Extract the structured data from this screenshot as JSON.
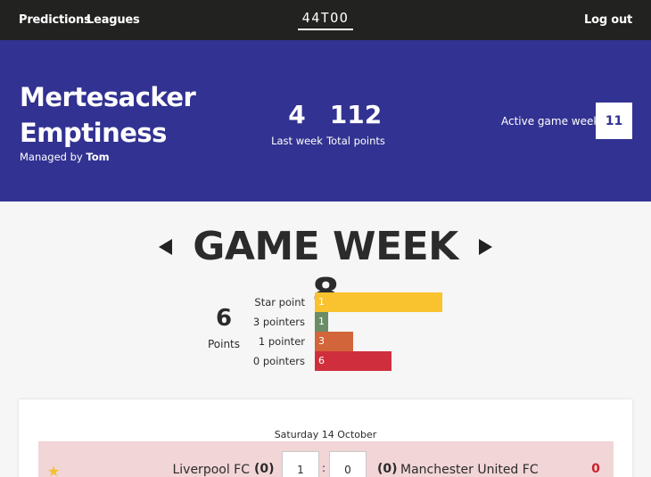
{
  "nav": {
    "predictions": "Predictions",
    "leagues": "Leagues",
    "logo": "44TOO",
    "logout": "Log out"
  },
  "hero": {
    "team_name": "Mertesacker Emptiness",
    "managed_by_prefix": "Managed by",
    "manager": "Tom",
    "last_week_value": "4",
    "last_week_label": "Last week",
    "total_points_value": "112",
    "total_points_label": "Total points",
    "active_game_week_label": "Active game week",
    "active_game_week_value": "11"
  },
  "game_week": {
    "title": "GAME WEEK 8",
    "points_value": "6",
    "points_label": "Points",
    "breakdown": [
      {
        "label": "Star point",
        "count": 1,
        "color": "#f9c22f"
      },
      {
        "label": "3 pointers",
        "count": 1,
        "color": "#6a8c67"
      },
      {
        "label": "1 pointer",
        "count": 3,
        "color": "#d2653a"
      },
      {
        "label": "0 pointers",
        "count": 6,
        "color": "#cf2f3c"
      }
    ]
  },
  "fixtures": {
    "date": "Saturday 14 October",
    "matches": [
      {
        "home": "Liverpool FC",
        "home_actual": "(0)",
        "home_prediction": "1",
        "away_prediction": "0",
        "away_actual": "(0)",
        "away": "Manchester United FC",
        "points": "0",
        "row_color": "#f2d5d7",
        "starred": true
      }
    ]
  },
  "colors": {
    "nav_bg": "#222221",
    "hero_bg": "#323292",
    "accent": "#323292",
    "zero_points": "#c9222c"
  }
}
